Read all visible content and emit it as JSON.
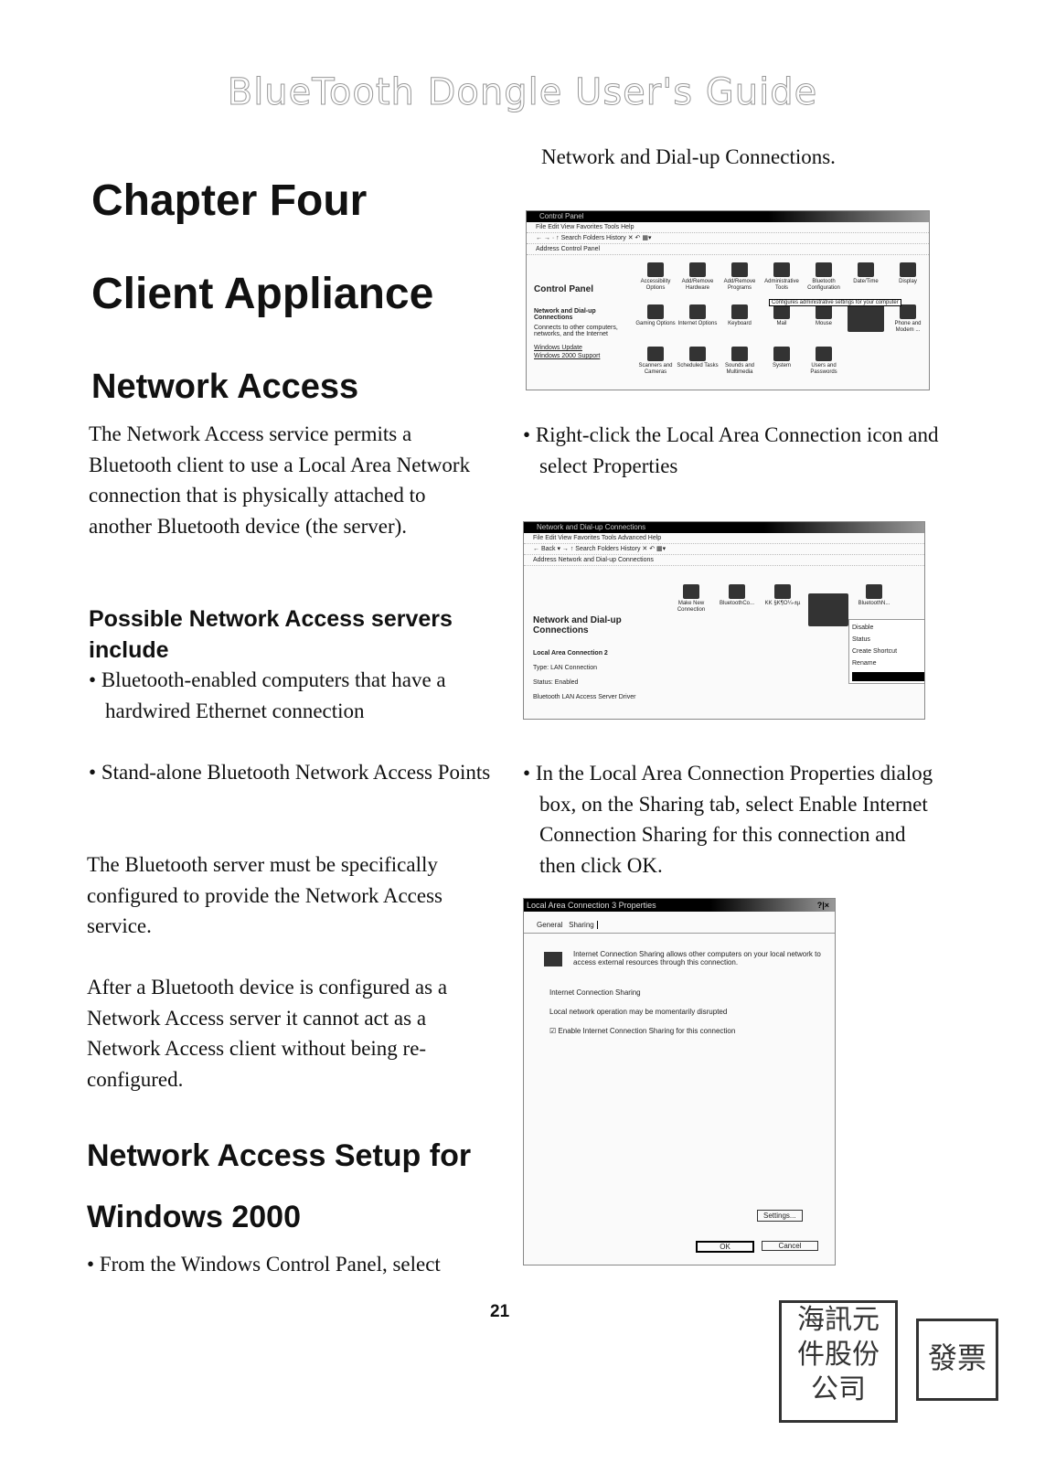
{
  "header": "BlueTooth Dongle User's Guide",
  "left": {
    "chapter": "Chapter Four",
    "chapter_title": "Client Appliance",
    "section": "Network Access",
    "intro": "The Network Access service permits a Bluetooth client to use a Local Area Network connection that is physically attached to another Bluetooth device (the server).",
    "servers_heading": "Possible Network Access servers include",
    "servers": [
      "Bluetooth-enabled computers that have a hardwired Ethernet connection",
      "Stand-alone Bluetooth Network Access Points"
    ],
    "para2": "The Bluetooth server must be specifically configured to provide the Network Access service.",
    "para3": "After a Bluetooth device is configured as a Network Access server it cannot act as a Network Access client without being re-configured.",
    "setup_heading_1": "Network Access Setup for",
    "setup_heading_2": "Windows 2000",
    "step1": "From the Windows Control Panel, select"
  },
  "right": {
    "step1_cont": "Network and Dial-up Connections.",
    "step2": "Right-click the Local Area Connection icon and select Properties",
    "step3": "In the Local Area Connection Properties dialog box, on the Sharing tab, select Enable Internet Connection Sharing for this connection and then click OK."
  },
  "shot1": {
    "title": "Control Panel",
    "menu": "File   Edit   View   Favorites   Tools   Help",
    "toolbar": "← → · ↑   Search   Folders   History   ✕  ↶  ▦▾",
    "address": "Address  Control Panel",
    "heading": "Control Panel",
    "link_title": "Network and Dial-up Connections",
    "link_desc": "Connects to other computers, networks, and the Internet",
    "links": [
      "Windows Update",
      "Windows 2000 Support"
    ],
    "icons": [
      "Accessibility Options",
      "Add/Remove Hardware",
      "Add/Remove Programs",
      "Administrative Tools",
      "Bluetooth Configuration",
      "Date/Time",
      "Display",
      "Gaming Options",
      "Internet Options",
      "Keyboard",
      "Mail",
      "Mouse",
      "",
      "Phone and Modem ...",
      "Scanners and Cameras",
      "Scheduled Tasks",
      "Sounds and Multimedia",
      "System",
      "Users and Passwords"
    ],
    "tooltip": "Configures administrative settings for your computer"
  },
  "shot2": {
    "title": "Network and Dial-up Connections",
    "menu": "File   Edit   View   Favorites   Tools   Advanced   Help",
    "toolbar": "← Back ▾  →  ↑   Search   Folders   History   ✕  ↶  ▦▾",
    "address": "Address  Network and Dial-up Connections",
    "heading": "Network and Dial-up Connections",
    "details": [
      "Local Area Connection 2",
      "Type: LAN Connection",
      "Status: Enabled",
      "Bluetooth LAN Access Server Driver"
    ],
    "icons": [
      "Make New Connection",
      "BluetoothCo...",
      "KK §K¶O¼-±µ",
      "",
      "BluetoothN..."
    ],
    "context_menu": [
      "Disable",
      "Status",
      "Create Shortcut",
      "Rename"
    ]
  },
  "shot3": {
    "title": "Local Area Connection 3 Properties",
    "title_buttons": "?|×",
    "tabs": [
      "General",
      "Sharing"
    ],
    "desc": "Internet Connection Sharing allows other computers on your local network to access external resources through this connection.",
    "group": "Internet Connection Sharing",
    "warning": "Local network operation may be momentarily disrupted",
    "checkbox_label": "Enable Internet Connection Sharing for this connection",
    "checkbox_checked": true,
    "settings": "Settings...",
    "ok": "OK",
    "cancel": "Cancel"
  },
  "page_number": "21",
  "seals": {
    "seal1": "海訊元件股份公司",
    "seal2": "發票"
  }
}
